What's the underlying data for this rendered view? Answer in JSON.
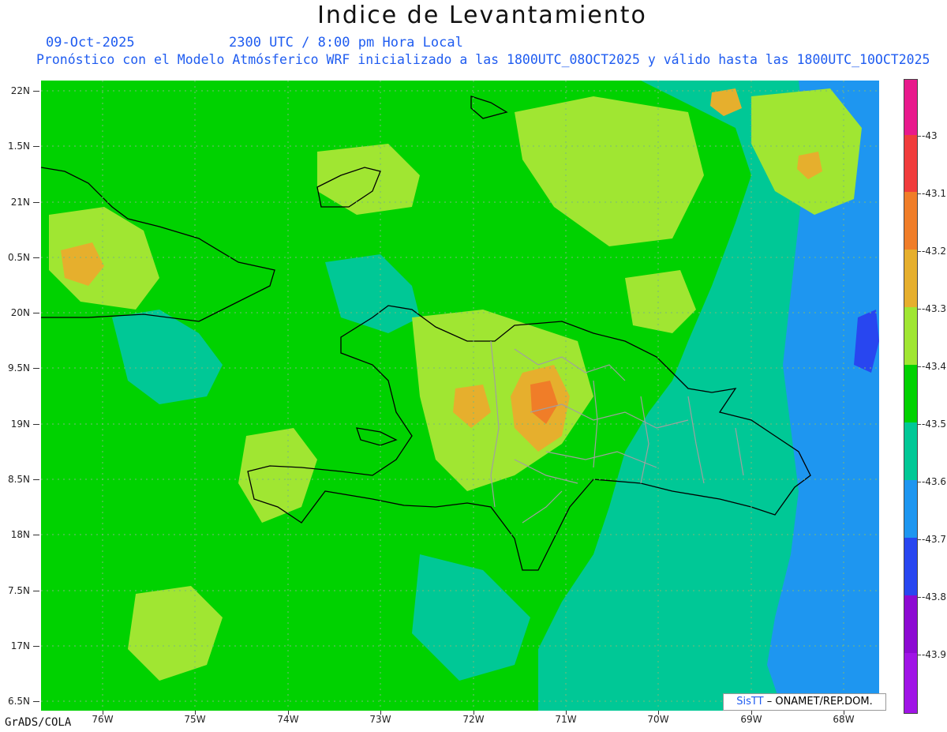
{
  "title": "Indice de Levantamiento",
  "date_text": "09-Oct-2025",
  "time_text": "2300 UTC / 8:00 pm Hora Local",
  "model_text": "Pronóstico con el Modelo Atmósferico WRF inicializado a las 1800UTC_08OCT2025 y válido hasta las  1800UTC_10OCT2025",
  "footer_text": "GrADS/COLA",
  "credit": {
    "brand": "SisTT",
    "rest": "– ONAMET/REP.DOM."
  },
  "lat_labels": [
    "22N",
    "1.5N",
    "21N",
    "0.5N",
    "20N",
    "9.5N",
    "19N",
    "8.5N",
    "18N",
    "7.5N",
    "17N",
    "6.5N"
  ],
  "lon_labels": [
    "76W",
    "75W",
    "74W",
    "73W",
    "72W",
    "71W",
    "70W",
    "69W",
    "68W"
  ],
  "colorbar": {
    "labels": [
      "-43",
      "-43.1",
      "-43.2",
      "-43.3",
      "-43.4",
      "-43.5",
      "-43.6",
      "-43.7",
      "-43.8",
      "-43.9"
    ],
    "colors": [
      "#e8198c",
      "#f03c3c",
      "#f07d28",
      "#e6af2d",
      "#a0e632",
      "#00d200",
      "#00c896",
      "#1e96f0",
      "#2846f0",
      "#8c0ad2",
      "#a014e6"
    ]
  },
  "field_colors": {
    "background": "#00d200",
    "light": "#a0e632",
    "teal": "#00c896",
    "blue": "#1e96f0",
    "darkblue": "#2846f0",
    "orange": "#e6af2d",
    "red": "#f07d28",
    "coast": "#000000",
    "border": "#a0a0a0"
  }
}
